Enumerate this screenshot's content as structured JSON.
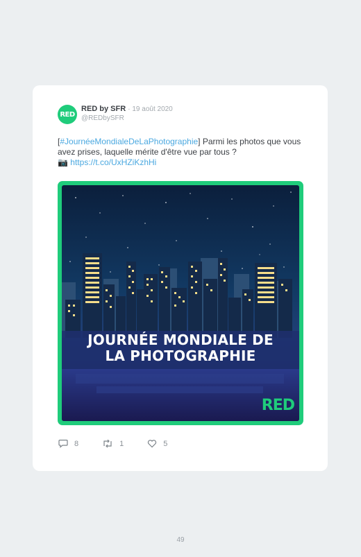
{
  "tweet": {
    "author_name": "RED by SFR",
    "date": "· 19 août 2020",
    "handle": "@REDbySFR",
    "avatar_text": "RED",
    "text_open_bracket": "[",
    "hashtag": "#JournéeMondialeDeLaPhotographie",
    "text_body": "] Parmi les photos que vous avez prises, laquelle mérite d'être vue par tous ?",
    "camera_emoji": "📷",
    "url": "https://t.co/UxHZiKzhHi"
  },
  "image": {
    "title_line1": "JOURNÉE MONDIALE DE",
    "title_line2": "LA PHOTOGRAPHIE",
    "logo_text": "RED",
    "accent_color": "#1fcc7b"
  },
  "actions": {
    "replies": "8",
    "retweets": "1",
    "likes": "5",
    "reply_icon": "speech-bubble-icon",
    "retweet_icon": "retweet-arrows-icon",
    "like_icon": "heart-icon"
  },
  "page": {
    "number": "49"
  }
}
